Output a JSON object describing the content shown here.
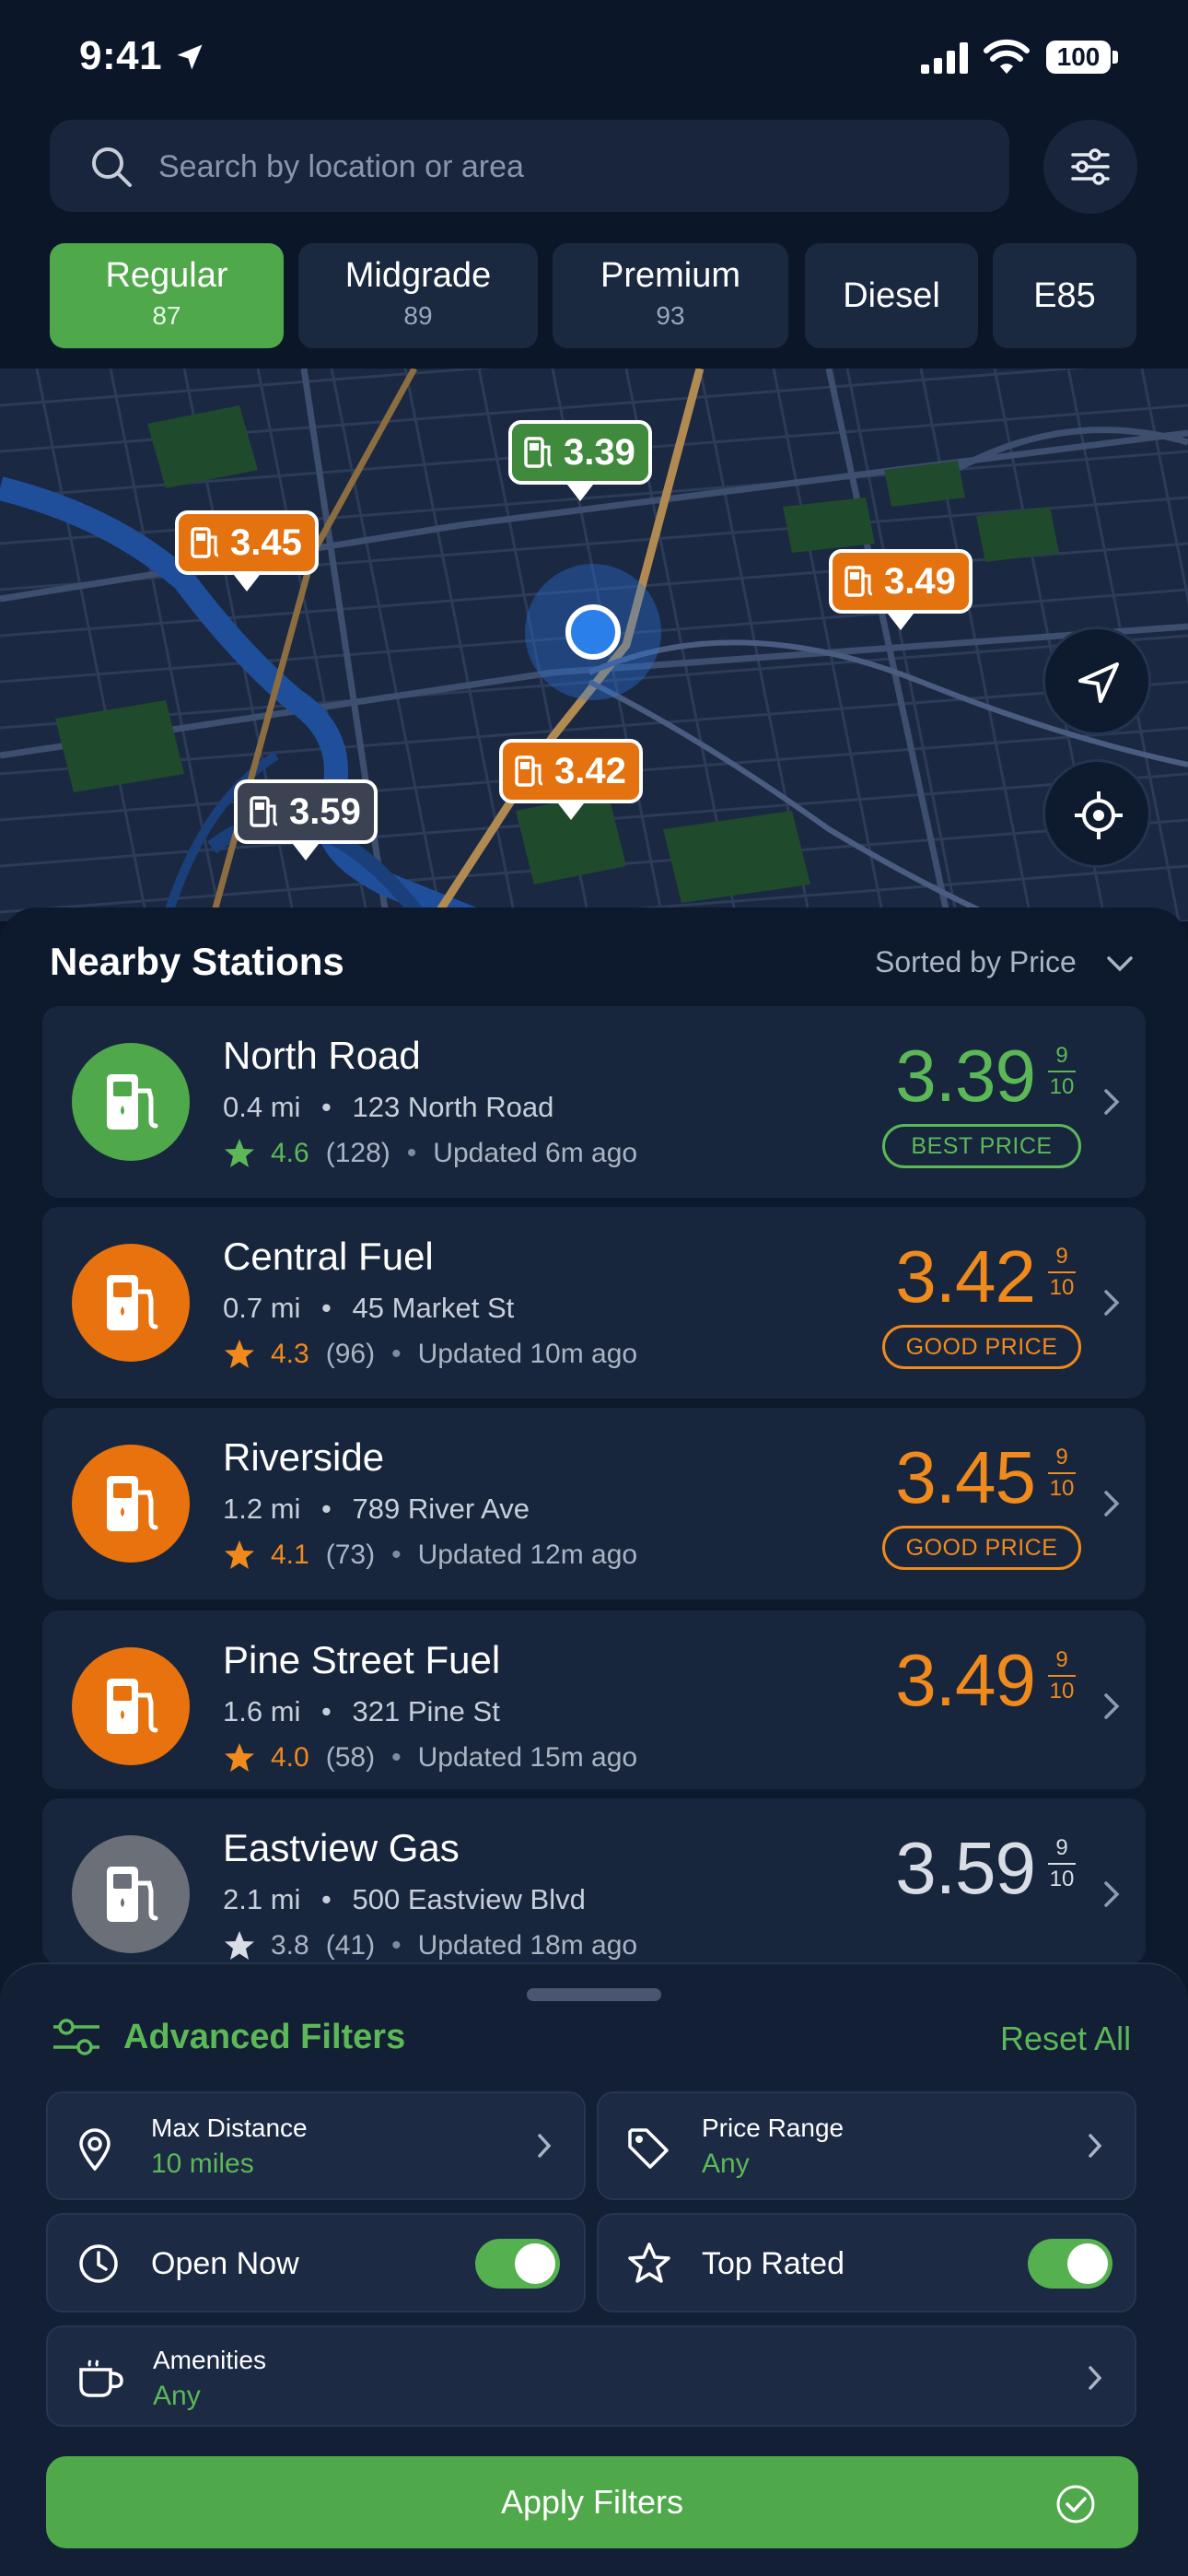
{
  "status_bar": {
    "time": "9:41",
    "battery": "100"
  },
  "search": {
    "placeholder": "Search by location or area"
  },
  "fuel_tabs": [
    {
      "name": "Regular",
      "octane": "87",
      "active": true
    },
    {
      "name": "Midgrade",
      "octane": "89",
      "active": false
    },
    {
      "name": "Premium",
      "octane": "93",
      "active": false
    },
    {
      "name": "Diesel",
      "octane": "",
      "active": false
    },
    {
      "name": "E85",
      "octane": "",
      "active": false
    }
  ],
  "map_markers": [
    {
      "price": "3.39",
      "color": "green"
    },
    {
      "price": "3.45",
      "color": "orange"
    },
    {
      "price": "3.49",
      "color": "orange"
    },
    {
      "price": "3.42",
      "color": "orange"
    },
    {
      "price": "3.59",
      "color": "gray"
    }
  ],
  "nearby": {
    "title": "Nearby Stations",
    "sort_label": "Sorted by Price",
    "stations": [
      {
        "name": "North Road",
        "distance": "0.4 mi",
        "address": "123 North Road",
        "rating": "4.6",
        "reviews": "(128)",
        "updated": "Updated 6m ago",
        "price": "3.39",
        "frac_num": "9",
        "frac_den": "10",
        "badge": "BEST PRICE",
        "color": "#5cb857",
        "logo_color": "#4fa84a"
      },
      {
        "name": "Central Fuel",
        "distance": "0.7 mi",
        "address": "45 Market St",
        "rating": "4.3",
        "reviews": "(96)",
        "updated": "Updated 10m ago",
        "price": "3.42",
        "frac_num": "9",
        "frac_den": "10",
        "badge": "GOOD PRICE",
        "color": "#f08a1c",
        "logo_color": "#e8730e"
      },
      {
        "name": "Riverside",
        "distance": "1.2 mi",
        "address": "789 River Ave",
        "rating": "4.1",
        "reviews": "(73)",
        "updated": "Updated 12m ago",
        "price": "3.45",
        "frac_num": "9",
        "frac_den": "10",
        "badge": "GOOD PRICE",
        "color": "#f08a1c",
        "logo_color": "#e8730e"
      },
      {
        "name": "Pine Street Fuel",
        "distance": "1.6 mi",
        "address": "321 Pine St",
        "rating": "4.0",
        "reviews": "(58)",
        "updated": "Updated 15m ago",
        "price": "3.49",
        "frac_num": "9",
        "frac_den": "10",
        "badge": "",
        "color": "#f08a1c",
        "logo_color": "#e8730e"
      },
      {
        "name": "Eastview Gas",
        "distance": "2.1 mi",
        "address": "500 Eastview Blvd",
        "rating": "3.8",
        "reviews": "(41)",
        "updated": "Updated 18m ago",
        "price": "3.59",
        "frac_num": "9",
        "frac_den": "10",
        "badge": "",
        "color": "#d8dde6",
        "logo_color": "#6b6f77"
      }
    ]
  },
  "filters": {
    "title": "Advanced Filters",
    "reset_label": "Reset All",
    "max_distance": {
      "label": "Max Distance",
      "value": "10 miles"
    },
    "price_range": {
      "label": "Price Range",
      "value": "Any"
    },
    "open_now": {
      "label": "Open Now",
      "enabled": true
    },
    "top_rated": {
      "label": "Top Rated",
      "enabled": true
    },
    "amenities": {
      "label": "Amenities",
      "value": "Any"
    },
    "apply_label": "Apply Filters"
  },
  "colors": {
    "accent_green": "#4fa84a",
    "accent_orange": "#e8730e",
    "background": "#0b1629"
  }
}
